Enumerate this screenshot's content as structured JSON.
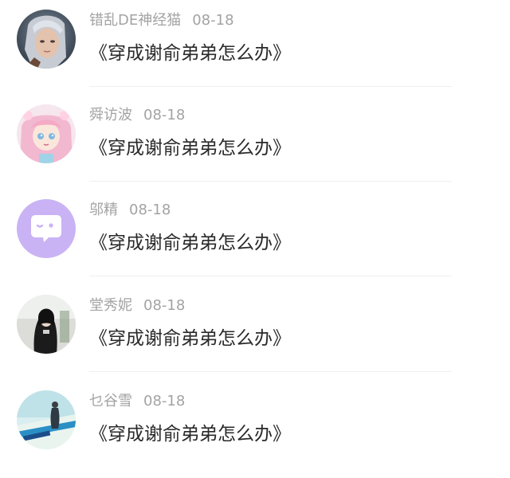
{
  "comments": [
    {
      "username": "错乱DE神经猫",
      "date": "08-18",
      "text": "《穿成谢俞弟弟怎么办》",
      "avatar_icon": "fantasy-character-avatar-icon"
    },
    {
      "username": "舜访波",
      "date": "08-18",
      "text": "《穿成谢俞弟弟怎么办》",
      "avatar_icon": "anime-girl-avatar-icon"
    },
    {
      "username": "邬精",
      "date": "08-18",
      "text": "《穿成谢俞弟弟怎么办》",
      "avatar_icon": "chat-bubble-avatar-icon"
    },
    {
      "username": "堂秀妮",
      "date": "08-18",
      "text": "《穿成谢俞弟弟怎么办》",
      "avatar_icon": "girl-photo-avatar-icon"
    },
    {
      "username": "乜谷雪",
      "date": "08-18",
      "text": "《穿成谢俞弟弟怎么办》",
      "avatar_icon": "beach-photo-avatar-icon"
    }
  ],
  "colors": {
    "username": "#a3a3a3",
    "text": "#2a2a2a",
    "chat_avatar_bg": "#c9b3f4",
    "divider": "#efefef"
  }
}
